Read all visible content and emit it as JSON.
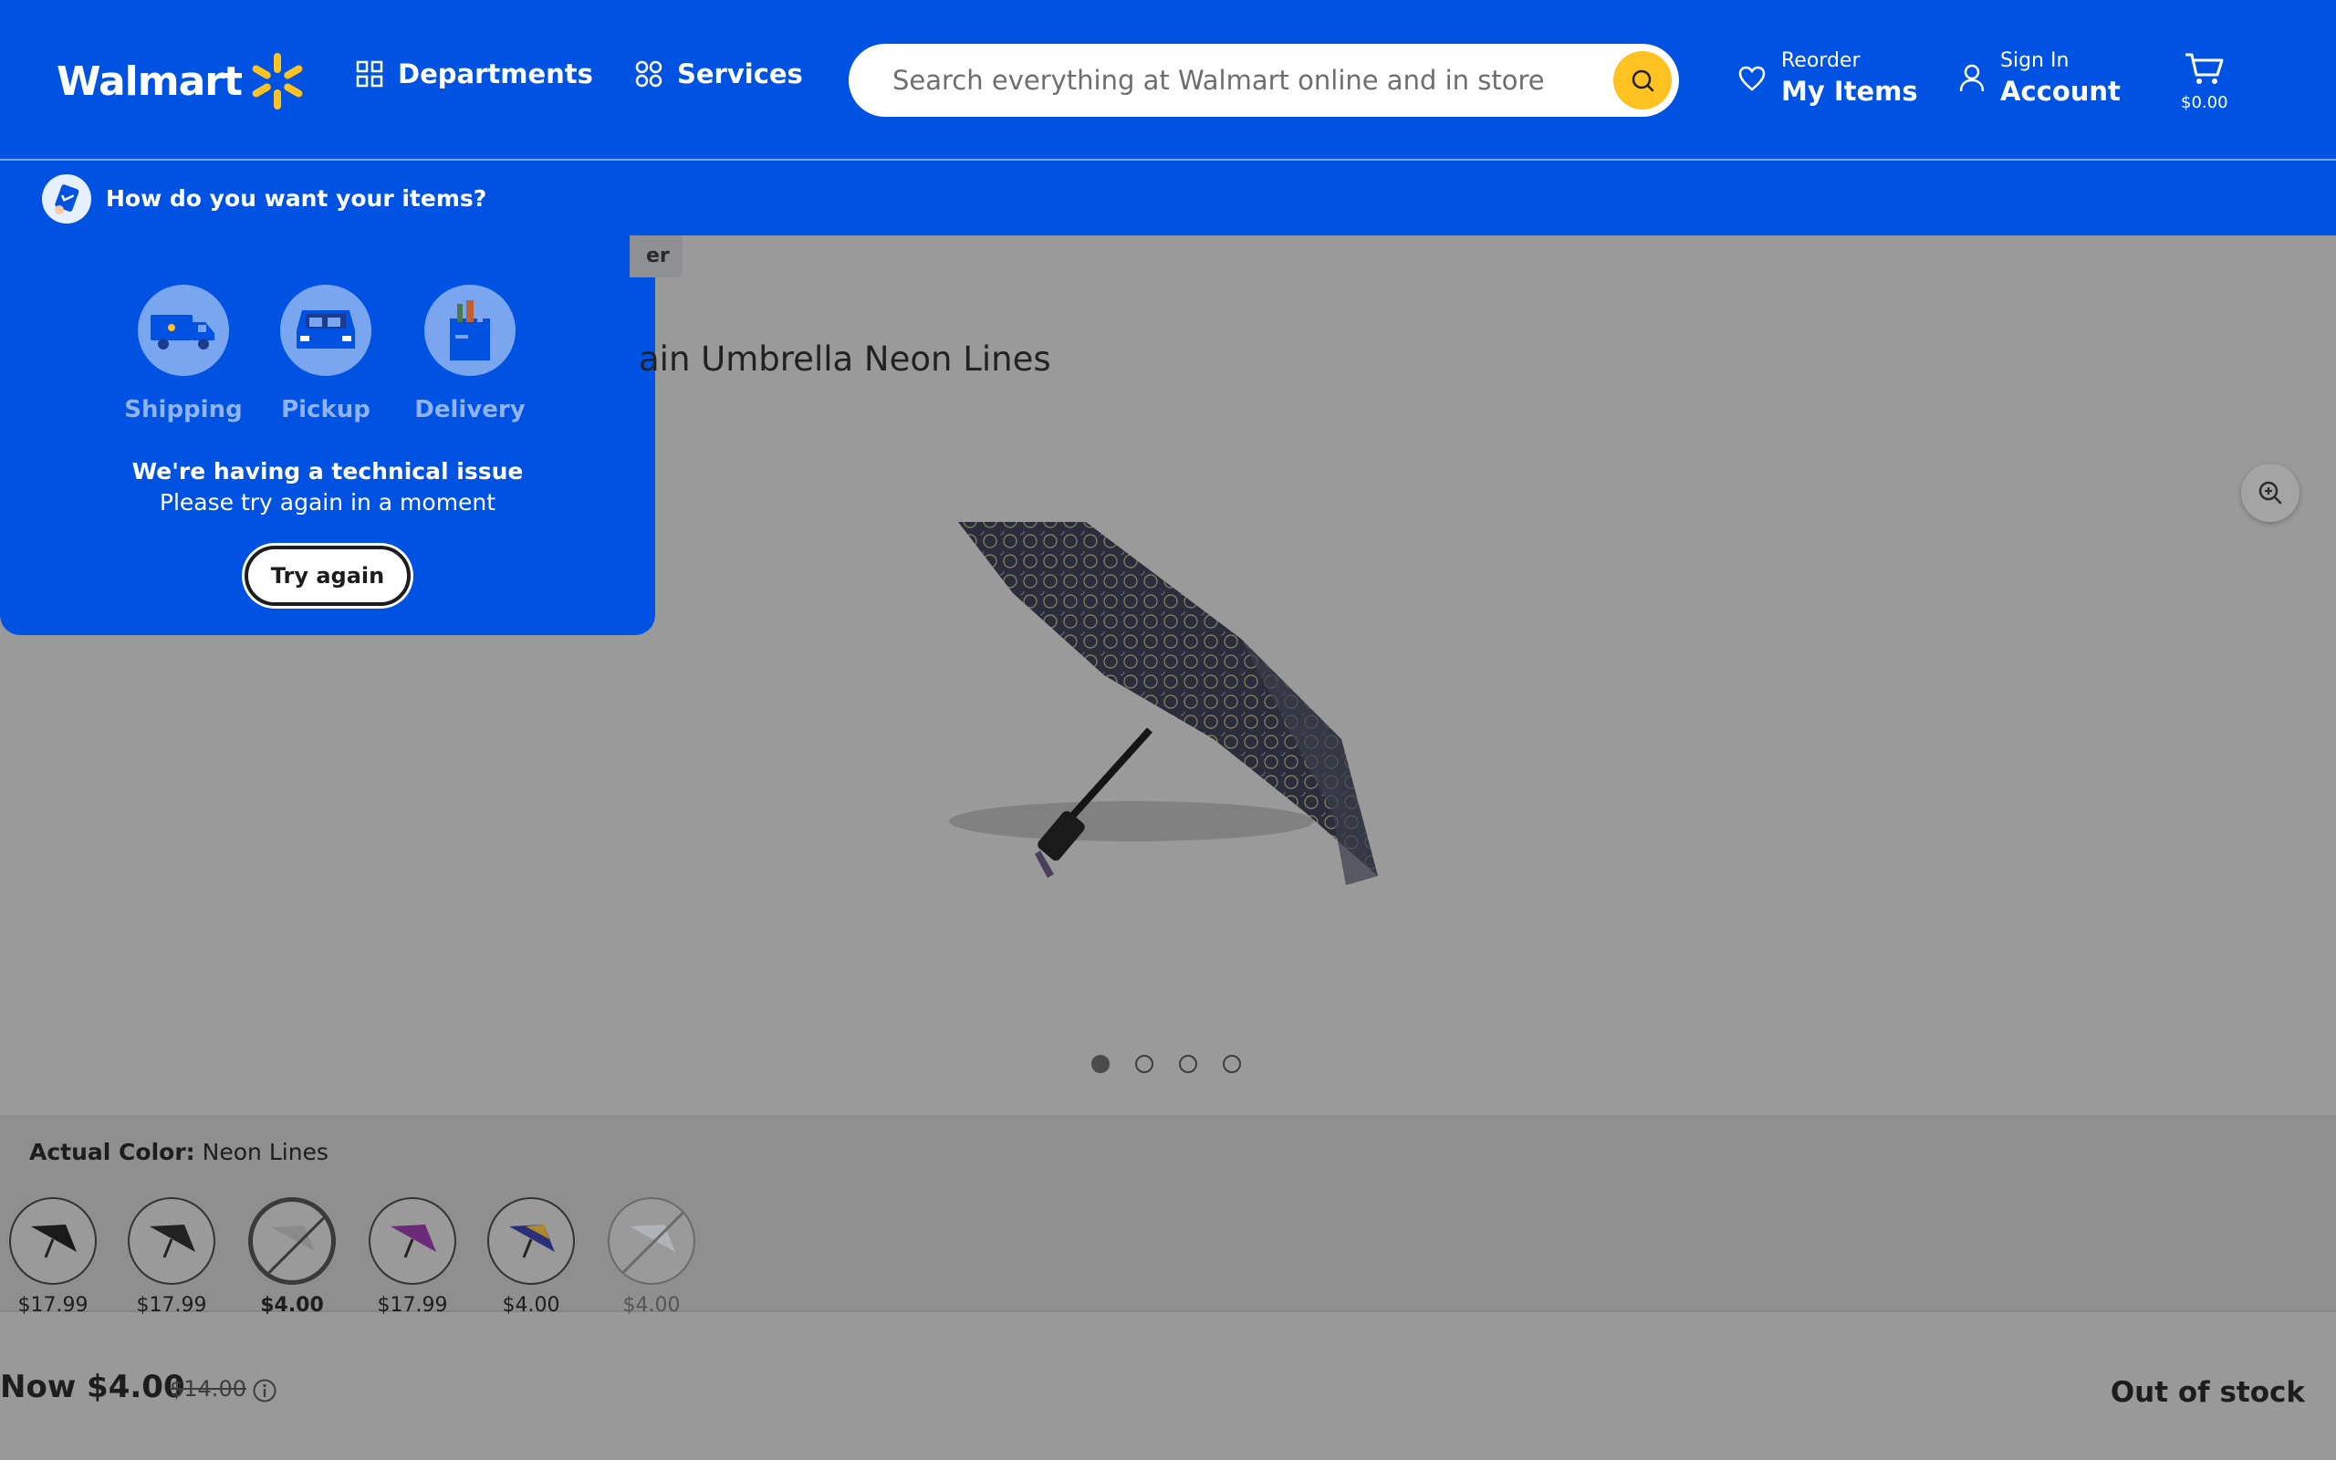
{
  "header": {
    "logo_text": "Walmart",
    "departments_label": "Departments",
    "services_label": "Services",
    "search_placeholder": "Search everything at Walmart online and in store",
    "reorder_small": "Reorder",
    "reorder_big": "My Items",
    "signin_small": "Sign In",
    "signin_big": "Account",
    "cart_amount": "$0.00"
  },
  "fulfillment": {
    "bar_label": "How do you want your items?",
    "options": [
      {
        "label": "Shipping",
        "icon": "truck-icon"
      },
      {
        "label": "Pickup",
        "icon": "car-icon"
      },
      {
        "label": "Delivery",
        "icon": "bag-icon"
      }
    ],
    "issue_title": "We're having a technical issue",
    "issue_subtitle": "Please try again in a moment",
    "try_again_label": "Try again"
  },
  "product": {
    "tag_text": "er",
    "title": "ain Umbrella Neon Lines",
    "image_dots": 4,
    "active_dot": 0,
    "color_label": "Actual Color:",
    "color_value": "Neon Lines",
    "swatches": [
      {
        "price": "$17.99",
        "state": "normal"
      },
      {
        "price": "$17.99",
        "state": "normal"
      },
      {
        "price": "$4.00",
        "state": "selected-unavailable"
      },
      {
        "price": "$17.99",
        "state": "normal"
      },
      {
        "price": "$4.00",
        "state": "normal"
      },
      {
        "price": "$4.00",
        "state": "unavailable"
      }
    ],
    "now_price": "Now $4.00",
    "was_price": "$14.00",
    "stock_status": "Out of stock"
  },
  "colors": {
    "brand_blue": "#0053e2",
    "spark_yellow": "#ffc220",
    "overlay_gray": "#9a9a9a"
  }
}
